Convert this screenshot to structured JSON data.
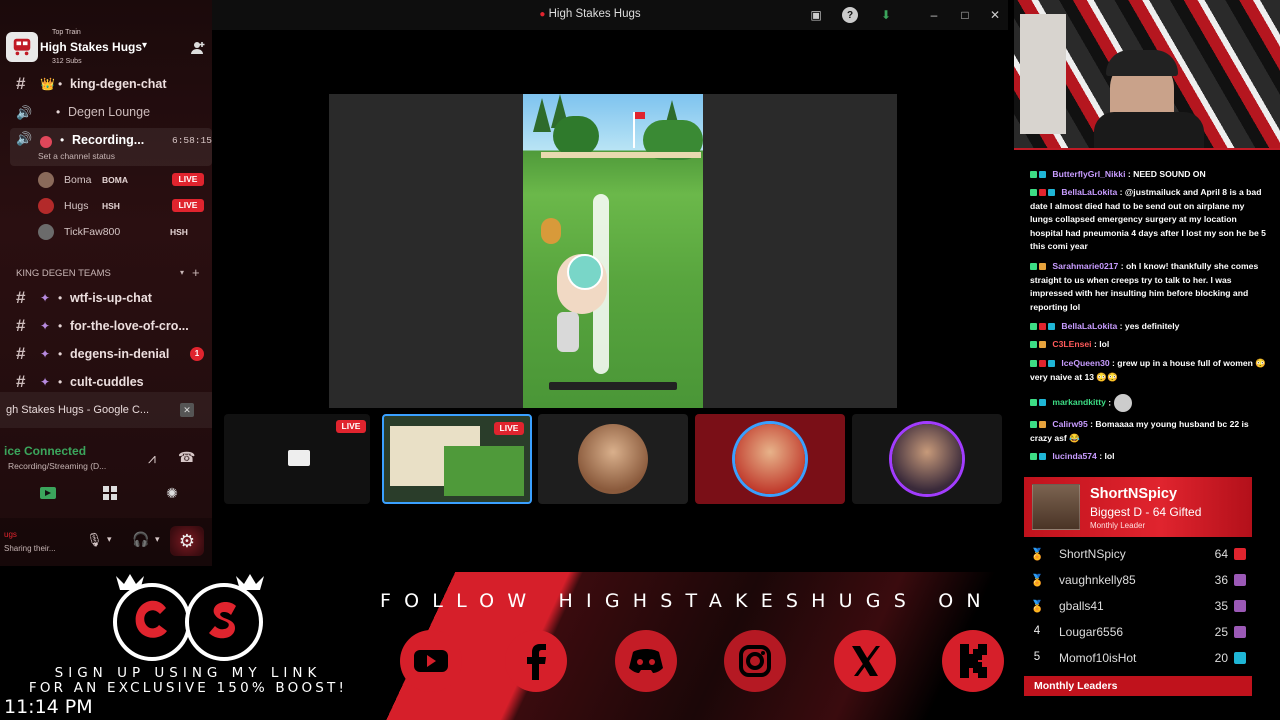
{
  "colors": {
    "accent": "#e0242e",
    "voice_green": "#3ba55c",
    "sidebar_bg": "#1e0b0c"
  },
  "window": {
    "title": "High Stakes Hugs"
  },
  "server": {
    "top_label": "Top Train",
    "name": "High Stakes Hugs",
    "subs": "312 Subs"
  },
  "sidebar": {
    "channels_top": [
      {
        "emoji": "👑",
        "label": "king-degen-chat"
      },
      {
        "label": "Degen Lounge"
      }
    ],
    "recording": {
      "label": "Recording...",
      "time": "6:58:15",
      "status": "Set a channel status"
    },
    "members": [
      {
        "name": "Boma",
        "tag": "BOMA",
        "live": "LIVE"
      },
      {
        "name": "Hugs",
        "tag": "HSH",
        "live": "LIVE"
      },
      {
        "name": "TickFaw800",
        "tag": "HSH",
        "live": ""
      }
    ],
    "category": "KING DEGEN TEAMS",
    "channels": [
      {
        "label": "wtf-is-up-chat",
        "badge": ""
      },
      {
        "label": "for-the-love-of-cro...",
        "badge": ""
      },
      {
        "label": "degens-in-denial",
        "badge": "1"
      },
      {
        "label": "cult-cuddles",
        "badge": ""
      }
    ],
    "activity": "gh Stakes Hugs - Google C...",
    "voice": {
      "title": "ice Connected",
      "sub": "Recording/Streaming (D..."
    },
    "user": {
      "name": "ugs",
      "status": "Sharing their..."
    }
  },
  "tiles": {
    "live_label": "LIVE"
  },
  "chat": [
    {
      "user": "ButterflyGrl_Nikki",
      "color": "#c89cff",
      "text": "NEED SOUND ON"
    },
    {
      "user": "BellaLaLokita",
      "color": "#c89cff",
      "text": "@justmailuck and April 8 is a bad date I almost died had to be send out on airplane my lungs collapsed emergency surgery at my location hospital had pneumonia 4 days after I lost my son he be 5 this comi year"
    },
    {
      "user": "Sarahmarie0217",
      "color": "#c89cff",
      "text": "oh I know! thankfully she comes straight to us when creeps try to talk to her. I was impressed with her insulting him before blocking and reporting lol"
    },
    {
      "user": "BellaLaLokita",
      "color": "#c89cff",
      "text": "yes definitely"
    },
    {
      "user": "C3LEnsei",
      "color": "#ff5a5a",
      "text": "lol"
    },
    {
      "user": "IceQueen30",
      "color": "#c89cff",
      "text": "grew up in a house full of women 😳 very naive at 13 😳😳"
    },
    {
      "user": "markandkitty",
      "color": "#3ddc84",
      "text": ""
    },
    {
      "user": "Calirw95",
      "color": "#c89cff",
      "text": "Bomaaaa my young husband bc 22 is crazy asf 😂"
    },
    {
      "user": "lucinda574",
      "color": "#c89cff",
      "text": "lol"
    }
  ],
  "leaderboard": {
    "top": {
      "name": "ShortNSpicy",
      "sub": "Biggest D - 64 Gifted",
      "period": "Monthly Leader"
    },
    "rows": [
      {
        "rank": "",
        "name": "ShortNSpicy",
        "count": "64",
        "gift_color": "#e0242e"
      },
      {
        "rank": "",
        "name": "vaughnkelly85",
        "count": "36",
        "gift_color": "#9b59b6"
      },
      {
        "rank": "",
        "name": "gballs41",
        "count": "35",
        "gift_color": "#9b59b6"
      },
      {
        "rank": "4",
        "name": "Lougar6556",
        "count": "25",
        "gift_color": "#9b59b6"
      },
      {
        "rank": "5",
        "name": "Momof10isHot",
        "count": "20",
        "gift_color": "#1fb6d6"
      }
    ],
    "footer": "Monthly Leaders"
  },
  "banner": {
    "follow": "FOLLOW HIGHSTAKESHUGS ON"
  },
  "promo": {
    "line1": "SIGN UP USING MY LINK",
    "line2": "FOR AN EXCLUSIVE 150% BOOST!"
  },
  "clock": "11:14 PM"
}
